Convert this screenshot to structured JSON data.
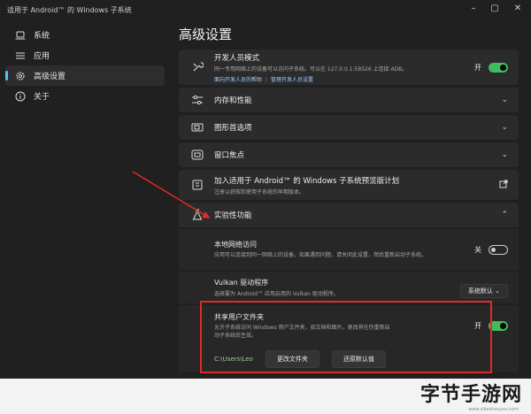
{
  "window": {
    "title": "适用于 Android™ 的 Windows 子系统"
  },
  "sidebar": {
    "items": [
      {
        "label": "系统",
        "icon": "laptop-icon",
        "active": false
      },
      {
        "label": "应用",
        "icon": "list-icon",
        "active": false
      },
      {
        "label": "高级设置",
        "icon": "gear-icon",
        "active": true
      },
      {
        "label": "关于",
        "icon": "info-icon",
        "active": false
      }
    ]
  },
  "main": {
    "title": "高级设置",
    "dev_mode": {
      "label": "开发人员模式",
      "desc": "同一专用网络上的设备可以访问子系统。可以在 127.0.0.1:58526 上连接 ADB。",
      "link1": "面向开发人员的帮助",
      "link2": "管理开发人员设置",
      "state": "开"
    },
    "memory": {
      "label": "内存和性能"
    },
    "graphics": {
      "label": "图形首选项"
    },
    "focus": {
      "label": "窗口焦点"
    },
    "preview": {
      "label": "加入适用于 Android™ 的 Windows 子系统预览版计划",
      "desc": "注册以获取和使用子系统的早期版本。"
    },
    "experimental": {
      "label": "实验性功能"
    },
    "local_net": {
      "label": "本地网络访问",
      "desc": "应用可以连接到同一网络上的设备。如果遇到问题，请关闭此设置，然后重新启动子系统。",
      "state": "关"
    },
    "vulkan": {
      "label": "Vulkan 驱动程序",
      "desc": "选择要为 Android™ 应用启用的 Vulkan 驱动程序。",
      "value": "系统默认"
    },
    "shared": {
      "label": "共享用户文件夹",
      "desc": "允许子系统访问 Windows 用户文件夹，如文档和图片。更改将在你重新启动子系统后生效。",
      "state": "开",
      "path": "C:\\Users\\Leo",
      "change_btn": "更改文件夹",
      "reset_btn": "还原默认值"
    }
  },
  "watermark": {
    "text": "字节手游网",
    "sub": "www.zijieshouyou.com"
  },
  "colors": {
    "accent": "#4cc2ff",
    "toggle_green": "#3dbd5b",
    "highlight": "#e02a2a"
  }
}
